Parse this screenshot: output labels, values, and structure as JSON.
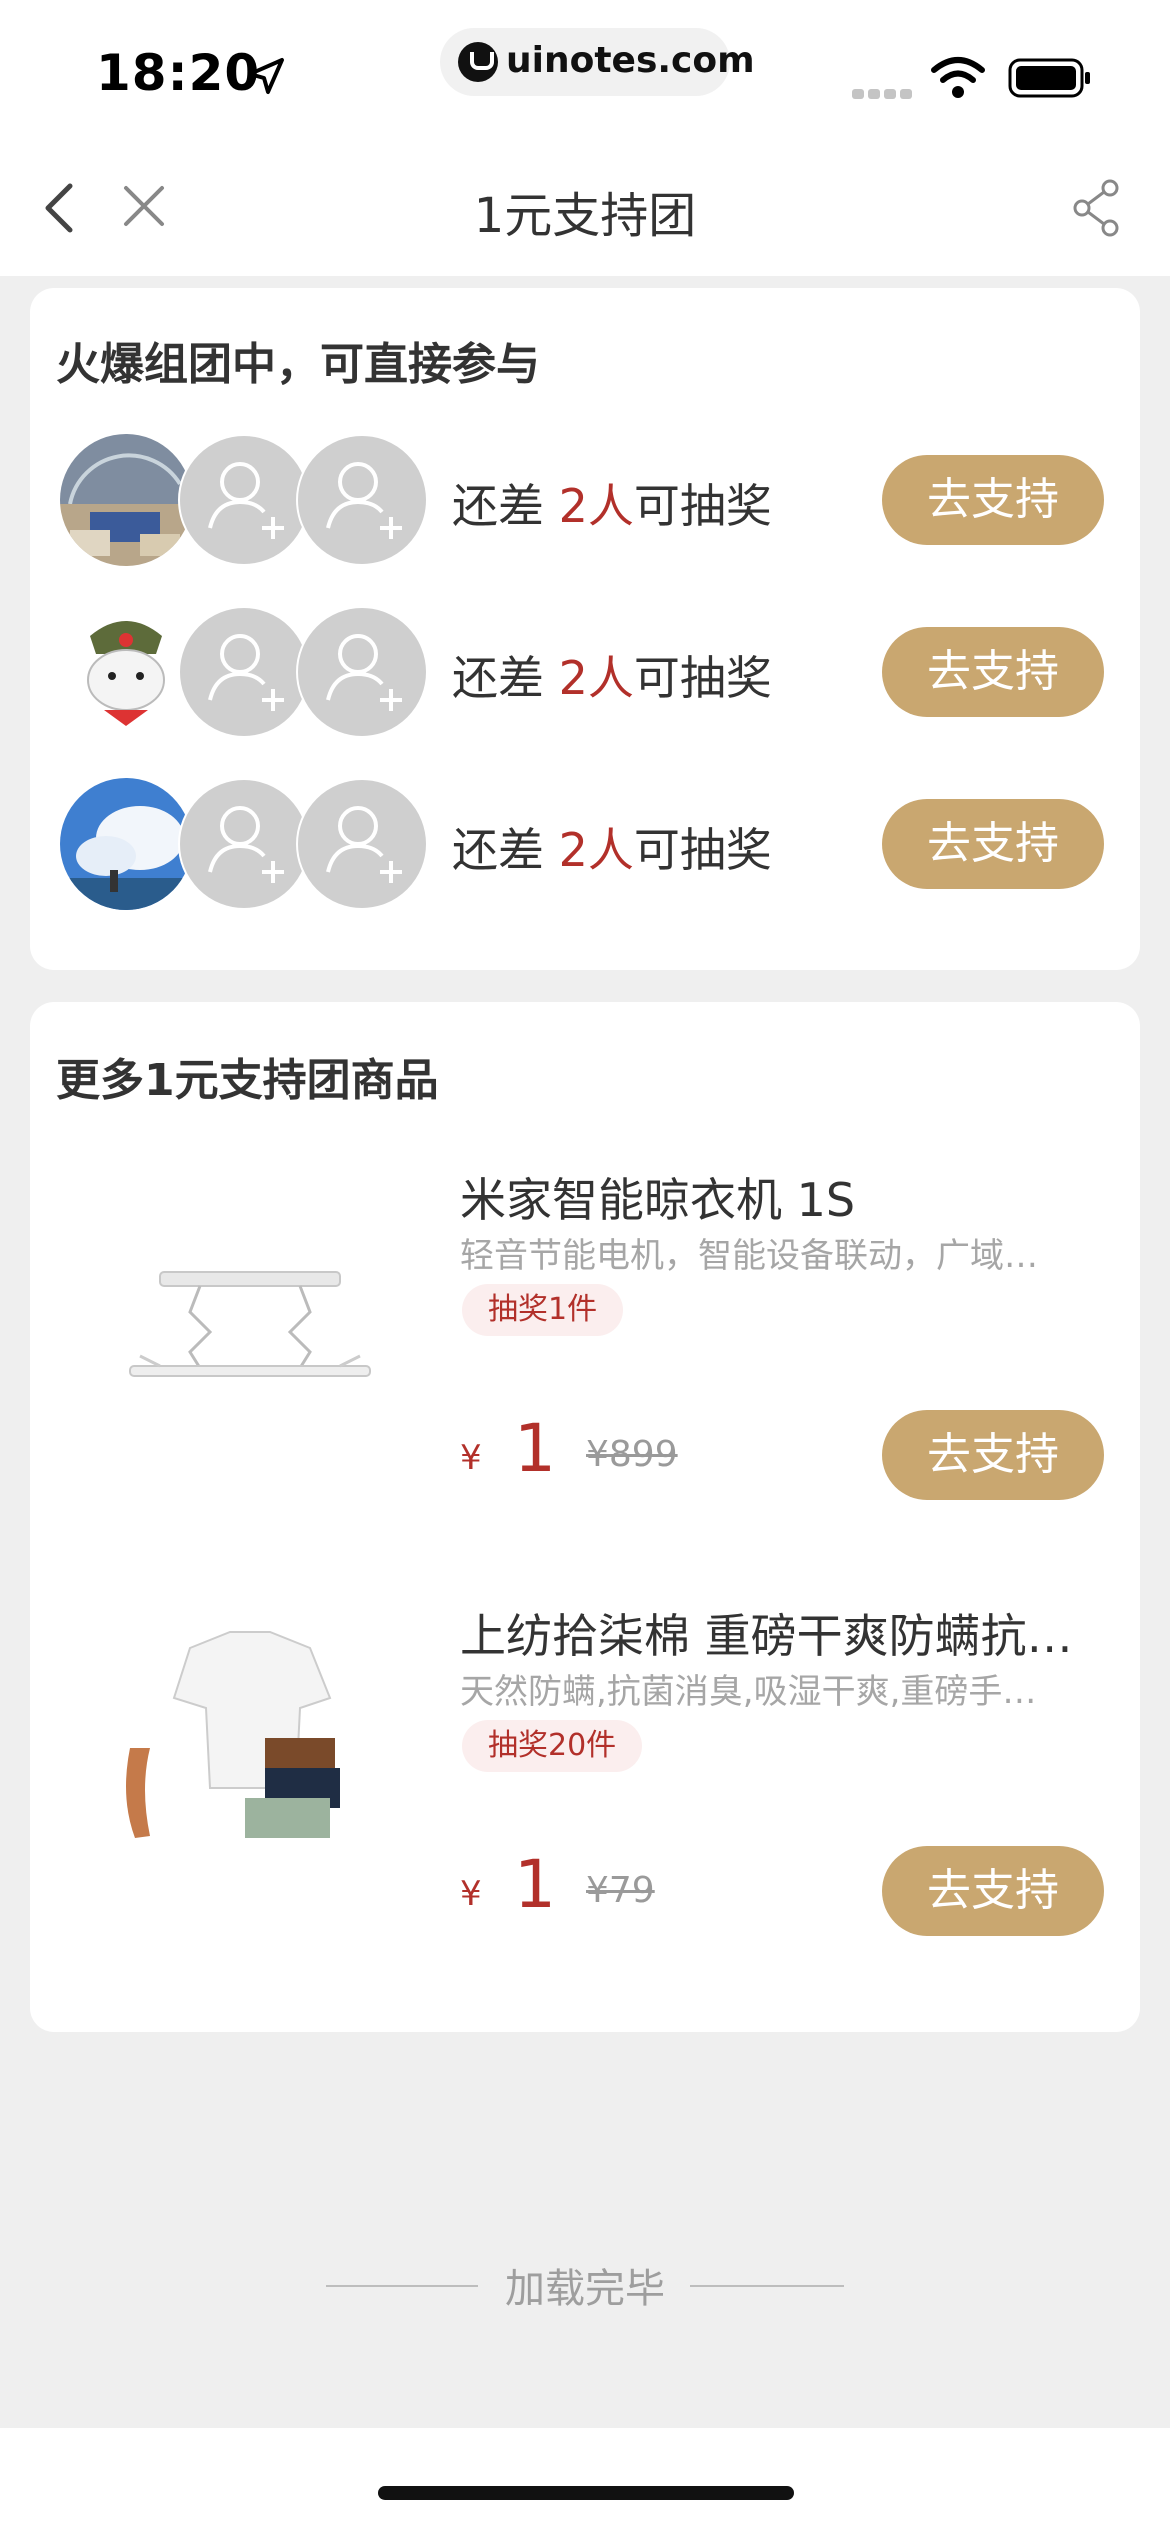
{
  "status_bar": {
    "time": "18:20",
    "url": "uinotes.com"
  },
  "nav": {
    "title": "1元支持团"
  },
  "groups_section": {
    "title": "火爆组团中，可直接参与",
    "rows": [
      {
        "prefix": "还差 ",
        "count": "2人",
        "suffix": "可抽奖",
        "button": "去支持"
      },
      {
        "prefix": "还差 ",
        "count": "2人",
        "suffix": "可抽奖",
        "button": "去支持"
      },
      {
        "prefix": "还差 ",
        "count": "2人",
        "suffix": "可抽奖",
        "button": "去支持"
      }
    ]
  },
  "products_section": {
    "title": "更多1元支持团商品",
    "items": [
      {
        "name": "米家智能晾衣机 1S",
        "desc": "轻音节能电机，智能设备联动，广域…",
        "tag": "抽奖1件",
        "currency": "¥",
        "price": "1",
        "original_price": "¥899",
        "button": "去支持"
      },
      {
        "name": "上纺拾柒棉 重磅干爽防螨抗…",
        "desc": "天然防螨,抗菌消臭,吸湿干爽,重磅手…",
        "tag": "抽奖20件",
        "currency": "¥",
        "price": "1",
        "original_price": "¥79",
        "button": "去支持"
      }
    ]
  },
  "footer": {
    "text": "加载完毕"
  },
  "colors": {
    "accent": "#c9a770",
    "price": "#b2302a",
    "background": "#efefef"
  }
}
